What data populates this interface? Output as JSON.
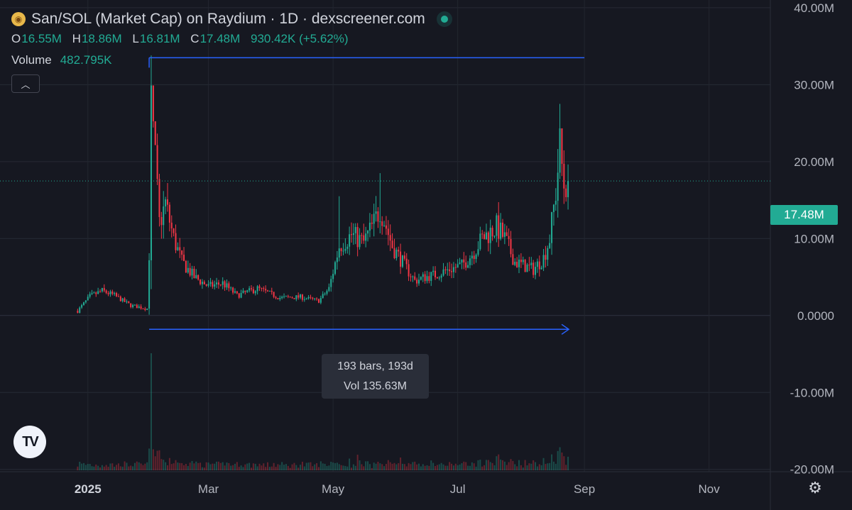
{
  "legend": {
    "coin_icon": "coin-icon",
    "title": "San/SOL (Market Cap) on Raydium · 1D · dexscreener.com",
    "ohlc": [
      {
        "k": "O",
        "v": "16.55M"
      },
      {
        "k": "H",
        "v": "18.86M"
      },
      {
        "k": "L",
        "v": "16.81M"
      },
      {
        "k": "C",
        "v": "17.48M"
      },
      {
        "k": "",
        "v": "930.42K (+5.62%)"
      }
    ],
    "volume_label": "Volume",
    "volume_value": "482.795K",
    "collapse_icon": "chevron-up-icon"
  },
  "measure": {
    "bars": "193 bars, 193d",
    "vol": "Vol 135.63M"
  },
  "current_price_label": "17.48M",
  "colors": {
    "up": "#22ab94",
    "down": "#f23645",
    "drawing": "#2962ff",
    "background": "#161821"
  },
  "chart_data": {
    "type": "candlestick",
    "title": "San/SOL (Market Cap) on Raydium · 1D · dexscreener.com",
    "y_unit": "M",
    "y_ticks": [
      {
        "value": 40,
        "label": "40.00M"
      },
      {
        "value": 30,
        "label": "30.00M"
      },
      {
        "value": 20,
        "label": "20.00M"
      },
      {
        "value": 10,
        "label": "10.00M"
      },
      {
        "value": 0,
        "label": "0.0000"
      },
      {
        "value": -10,
        "label": "-10.00M"
      },
      {
        "value": -20,
        "label": "-20.00M"
      }
    ],
    "ylim": [
      -20.3,
      41.0
    ],
    "x_ticks": [
      {
        "date": "2025-01-01",
        "label": "2025",
        "bold": true
      },
      {
        "date": "2025-03-01",
        "label": "Mar"
      },
      {
        "date": "2025-05-01",
        "label": "May"
      },
      {
        "date": "2025-07-01",
        "label": "Jul"
      },
      {
        "date": "2025-09-01",
        "label": "Sep"
      },
      {
        "date": "2025-11-01",
        "label": "Nov"
      }
    ],
    "xlim": [
      "2024-11-19",
      "2025-12-01"
    ],
    "series_start": "2024-12-27",
    "series_end": "2025-08-24",
    "close_path": [
      [
        "2024-12-27",
        0.6
      ],
      [
        "2025-01-02",
        2.5
      ],
      [
        "2025-01-08",
        3.2
      ],
      [
        "2025-01-14",
        2.6
      ],
      [
        "2025-01-22",
        1.3
      ],
      [
        "2025-01-30",
        0.9
      ],
      [
        "2025-01-31",
        8.0
      ],
      [
        "2025-02-01",
        27.0
      ],
      [
        "2025-02-03",
        20.0
      ],
      [
        "2025-02-05",
        12.0
      ],
      [
        "2025-02-08",
        14.5
      ],
      [
        "2025-02-12",
        10.0
      ],
      [
        "2025-02-16",
        7.0
      ],
      [
        "2025-02-22",
        5.0
      ],
      [
        "2025-03-01",
        3.8
      ],
      [
        "2025-03-08",
        4.2
      ],
      [
        "2025-03-15",
        2.6
      ],
      [
        "2025-03-25",
        3.5
      ],
      [
        "2025-04-05",
        2.3
      ],
      [
        "2025-04-15",
        2.4
      ],
      [
        "2025-04-24",
        1.9
      ],
      [
        "2025-04-29",
        3.5
      ],
      [
        "2025-05-04",
        9.0
      ],
      [
        "2025-05-10",
        10.5
      ],
      [
        "2025-05-16",
        9.5
      ],
      [
        "2025-05-21",
        12.0
      ],
      [
        "2025-05-24",
        14.0
      ],
      [
        "2025-05-30",
        9.0
      ],
      [
        "2025-06-05",
        6.5
      ],
      [
        "2025-06-10",
        4.5
      ],
      [
        "2025-06-15",
        5.0
      ],
      [
        "2025-06-20",
        5.3
      ],
      [
        "2025-06-27",
        6.0
      ],
      [
        "2025-07-03",
        6.5
      ],
      [
        "2025-07-08",
        8.0
      ],
      [
        "2025-07-13",
        10.0
      ],
      [
        "2025-07-20",
        11.5
      ],
      [
        "2025-07-24",
        10.0
      ],
      [
        "2025-07-29",
        7.0
      ],
      [
        "2025-08-02",
        6.5
      ],
      [
        "2025-08-07",
        6.0
      ],
      [
        "2025-08-12",
        7.5
      ],
      [
        "2025-08-15",
        10.0
      ],
      [
        "2025-08-18",
        16.0
      ],
      [
        "2025-08-20",
        22.0
      ],
      [
        "2025-08-22",
        17.0
      ],
      [
        "2025-08-24",
        17.48
      ]
    ],
    "current_price": 17.48,
    "drawings": {
      "horizontal_ray": {
        "from": "2025-01-31",
        "to": "2025-09-01",
        "value": 33.5
      },
      "date_range": {
        "from": "2025-01-31",
        "to": "2025-08-24",
        "value": -1.8
      }
    }
  }
}
